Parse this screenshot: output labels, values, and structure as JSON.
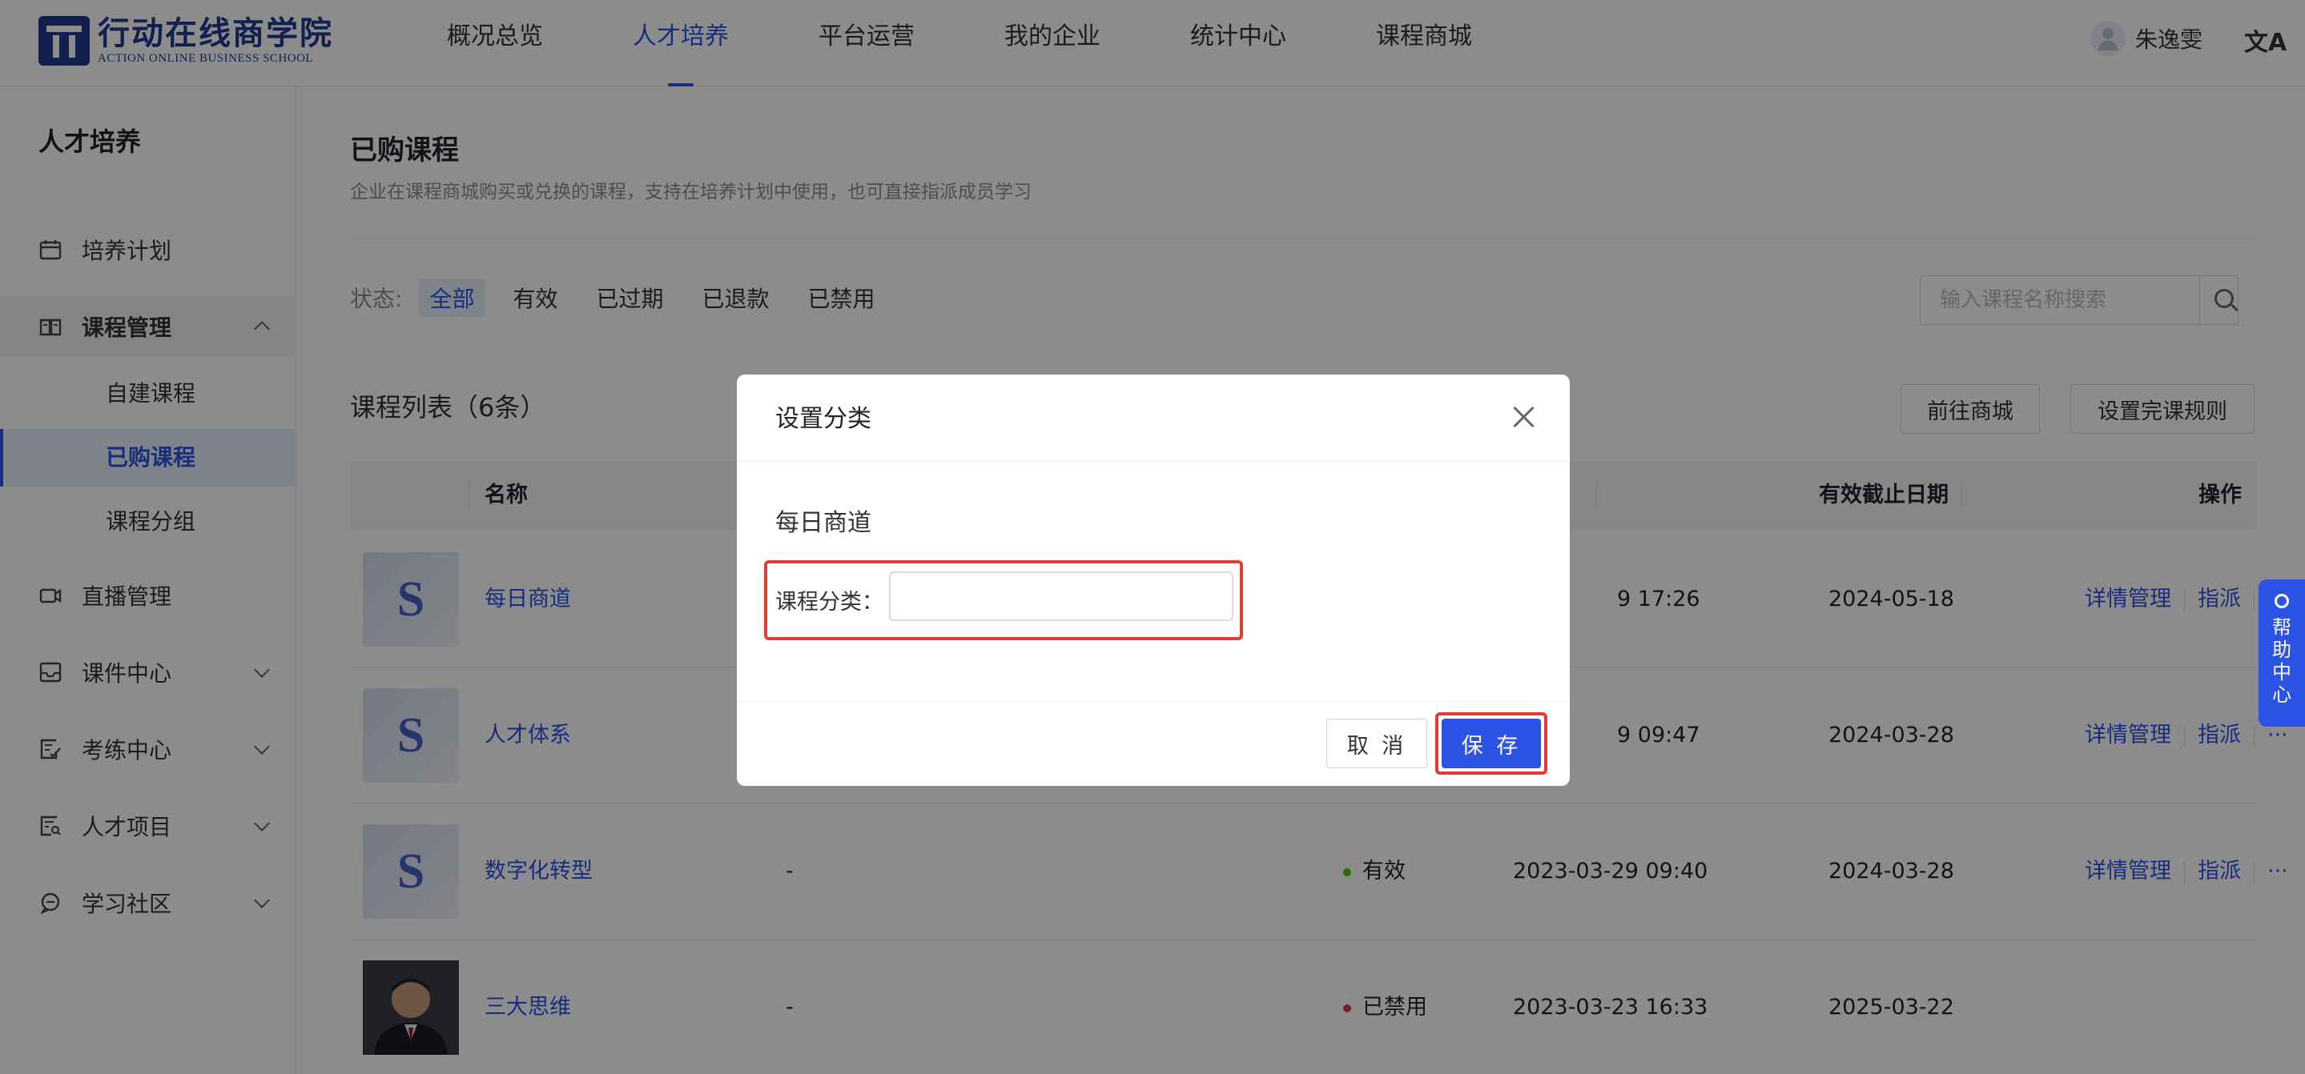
{
  "header": {
    "logo_cn": "行动在线商学院",
    "logo_en": "ACTION ONLINE BUSINESS SCHOOL",
    "nav": [
      "概况总览",
      "人才培养",
      "平台运营",
      "我的企业",
      "统计中心",
      "课程商城"
    ],
    "active_nav": "人才培养",
    "user_name": "朱逸雯",
    "translate_glyph": "文A"
  },
  "sidebar": {
    "title": "人才培养",
    "items": [
      {
        "label": "培养计划",
        "icon": "calendar-icon"
      },
      {
        "label": "课程管理",
        "icon": "book-icon",
        "expanded": true
      },
      {
        "label": "直播管理",
        "icon": "video-icon"
      },
      {
        "label": "课件中心",
        "icon": "inbox-icon"
      },
      {
        "label": "考练中心",
        "icon": "exam-icon"
      },
      {
        "label": "人才项目",
        "icon": "project-icon"
      },
      {
        "label": "学习社区",
        "icon": "chat-icon"
      }
    ],
    "sub_items": [
      "自建课程",
      "已购课程",
      "课程分组"
    ],
    "active_sub": "已购课程"
  },
  "main": {
    "title": "已购课程",
    "desc": "企业在课程商城购买或兑换的课程，支持在培养计划中使用，也可直接指派成员学习",
    "filter_label": "状态:",
    "filters": [
      "全部",
      "有效",
      "已过期",
      "已退款",
      "已禁用"
    ],
    "active_filter": "全部",
    "search_placeholder": "输入课程名称搜索",
    "list_title": "课程列表（6条）",
    "btn_store": "前往商城",
    "btn_rules": "设置完课规则",
    "columns": {
      "name": "名称",
      "deadline": "有效截止日期",
      "action": "操作"
    },
    "rows": [
      {
        "thumb": "S",
        "name": "每日商道",
        "group": "",
        "status": "",
        "status_color": "",
        "time": "9 17:26",
        "deadline": "2024-05-18",
        "actions": [
          "详情管理",
          "指派",
          "···"
        ]
      },
      {
        "thumb": "S",
        "name": "人才体系",
        "group": "",
        "status": "",
        "status_color": "",
        "time": "9 09:47",
        "deadline": "2024-03-28",
        "actions": [
          "详情管理",
          "指派",
          "···"
        ]
      },
      {
        "thumb": "S",
        "name": "数字化转型",
        "group": "-",
        "status": "有效",
        "status_color": "#52c41a",
        "time": "2023-03-29 09:40",
        "deadline": "2024-03-28",
        "actions": [
          "详情管理",
          "指派",
          "···"
        ]
      },
      {
        "thumb": "",
        "name": "三大思维",
        "group": "-",
        "status": "已禁用",
        "status_color": "#e53935",
        "time": "2023-03-23 16:33",
        "deadline": "2025-03-22",
        "actions": []
      }
    ]
  },
  "modal": {
    "title": "设置分类",
    "course_name": "每日商道",
    "field_label": "课程分类：",
    "field_value": "",
    "cancel": "取 消",
    "save": "保 存"
  },
  "help": {
    "label": "帮助中心"
  },
  "colors": {
    "primary": "#2b53e6",
    "highlight": "#e53935",
    "valid": "#52c41a"
  }
}
